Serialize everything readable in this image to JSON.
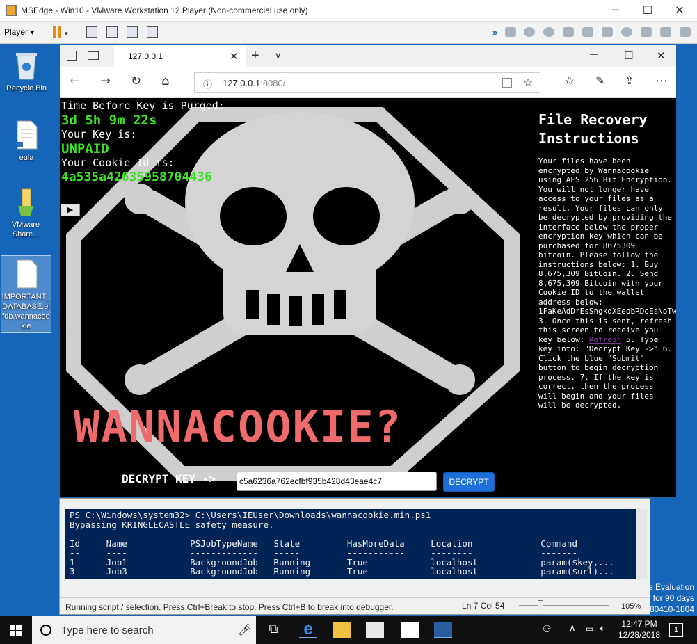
{
  "vm": {
    "title": "MSEdge - Win10 - VMware Workstation 12 Player (Non-commercial use only)",
    "player_menu": "Player"
  },
  "desktop": {
    "icons": [
      {
        "label": "Recycle Bin"
      },
      {
        "label": "eula"
      },
      {
        "label": "VMware Share..."
      },
      {
        "label": "IMPORTANT_DATABASE.elfdb.wannacookie"
      }
    ]
  },
  "browser": {
    "tab_title": "127.0.0.1",
    "url_host": "127.0.0.1",
    "url_port_path": ":8080/"
  },
  "page": {
    "timer_label": "Time Before Key is Purged:",
    "timer_value": "3d 5h 9m 22s",
    "key_label": "Your Key is:",
    "key_value": "UNPAID",
    "cookie_label": "Your Cookie Id is:",
    "cookie_value": "4a535a42635958704436",
    "logo_text": "WANNACOOKIE?",
    "instructions_title": "File Recovery Instructions",
    "instructions_body_1": "Your files have been encrypted by Wannacookie using AES 256 Bit Encryption. You will not longer have access to your files as a result. Your files can only be decrypted by providing the interface below the proper encryption key which can be purchased for 8675309 bitcoin. Please follow the instructions below: 1. Buy 8,675,309 BitCoin. 2. Send 8,675,309 Bitcoin with your Cookie ID to the wallet address below: 1FaKeAdDrEsSngkdXEeobRDoEsNoTw0rK 3. Once this is sent, refresh this screen to receive you key below:",
    "refresh_link": "Refresh",
    "instructions_body_2": "5. Type key into: \"Decrypt Key ->\" 6. Click the blue \"Submit\" button to begin decryption process. 7. If the key is correct, then the process will begin and your files will be decrypted.",
    "decrypt_label": "DECRYPT KEY ->",
    "decrypt_value": "c5a6236a762ecfbf935b428d43eae4c7",
    "decrypt_button": "DECRYPT"
  },
  "powershell": {
    "console_text": "PS C:\\Windows\\system32> C:\\Users\\IEUser\\Downloads\\wannacookie.min.ps1\nBypassing KRINGLECASTLE safety measure.\n\nId     Name            PSJobTypeName   State         HasMoreData     Location             Command\n--     ----            -------------   -----         -----------     --------             -------\n1      Job1            BackgroundJob   Running       True            localhost            param($key,...\n3      Job3            BackgroundJob   Running       True            localhost            param($url)...",
    "status_msg": "Running script / selection.  Press Ctrl+Break to stop.  Press Ctrl+B to break into debugger.",
    "cursor_pos": "Ln 7  Col 54",
    "zoom": "105%",
    "zoom_fraction": 0.21
  },
  "eval_text": "e Evaluation\nl for 90 days\n80410-1804",
  "taskbar": {
    "search_placeholder": "Type here to search",
    "time": "12:47 PM",
    "date": "12/28/2018",
    "notification_count": "1"
  }
}
